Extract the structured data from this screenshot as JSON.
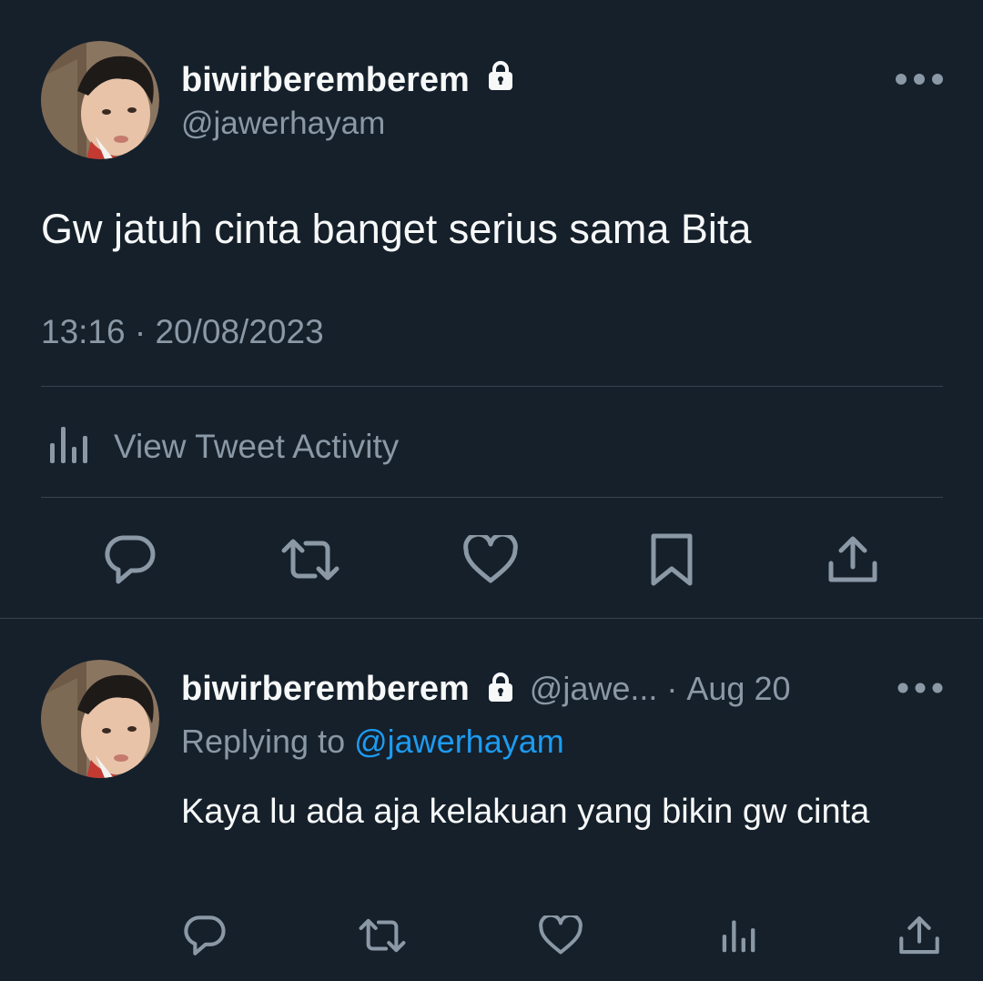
{
  "main_tweet": {
    "display_name": "biwirberemberem",
    "handle": "@jawerhayam",
    "text": "Gw jatuh cinta banget serius sama Bita",
    "timestamp": "13:16 · 20/08/2023",
    "activity_label": "View Tweet Activity",
    "actions": [
      "reply-icon",
      "retweet-icon",
      "like-icon",
      "bookmark-icon",
      "share-icon"
    ]
  },
  "reply": {
    "display_name": "biwirberemberem",
    "handle_truncated": "@jawe...",
    "separator": "·",
    "date": "Aug 20",
    "replying_prefix": "Replying to ",
    "replying_to": "@jawerhayam",
    "text": "Kaya lu ada aja kelakuan yang bikin gw cinta",
    "actions": [
      "reply-icon",
      "retweet-icon",
      "like-icon",
      "analytics-icon",
      "share-icon"
    ]
  },
  "colors": {
    "background": "#15202b",
    "text_primary": "#f7f9f9",
    "text_secondary": "#8b98a5",
    "divider": "#38444d",
    "link": "#1d9bf0"
  }
}
